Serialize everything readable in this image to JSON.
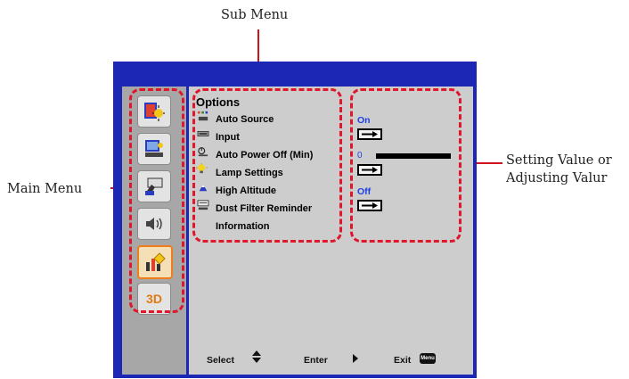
{
  "callouts": {
    "sub_menu": "Sub Menu",
    "main_menu": "Main Menu",
    "setting_line1": "Setting Value or",
    "setting_line2": "Adjusting Valur"
  },
  "osd": {
    "main_menu_tabs": [
      {
        "icon": "image-settings-icon"
      },
      {
        "icon": "display-settings-icon"
      },
      {
        "icon": "setup-icon"
      },
      {
        "icon": "volume-icon"
      },
      {
        "icon": "options-icon",
        "active": true
      },
      {
        "icon": "3d-icon",
        "label": "3D"
      }
    ],
    "submenu": {
      "title": "Options",
      "items": [
        {
          "label": "Auto Source",
          "icon": "auto-source-icon"
        },
        {
          "label": "Input",
          "icon": "input-icon"
        },
        {
          "label": "Auto Power Off (Min)",
          "icon": "power-timer-icon"
        },
        {
          "label": "Lamp Settings",
          "icon": "lamp-icon"
        },
        {
          "label": "High Altitude",
          "icon": "altitude-icon"
        },
        {
          "label": "Dust Filter Reminder",
          "icon": "filter-icon"
        },
        {
          "label": "Information"
        }
      ]
    },
    "values": {
      "auto_source": "On",
      "auto_power_off": "0",
      "auto_power_off_level": 0,
      "high_altitude": "Off"
    },
    "footer": {
      "select": "Select",
      "enter": "Enter",
      "exit": "Exit",
      "menu_key": "Menu"
    }
  },
  "colors": {
    "frame_blue": "#1c27b6",
    "callout_red": "#d0121b",
    "value_blue": "#1f3fe6",
    "active_tab": "#ef7d1a"
  }
}
